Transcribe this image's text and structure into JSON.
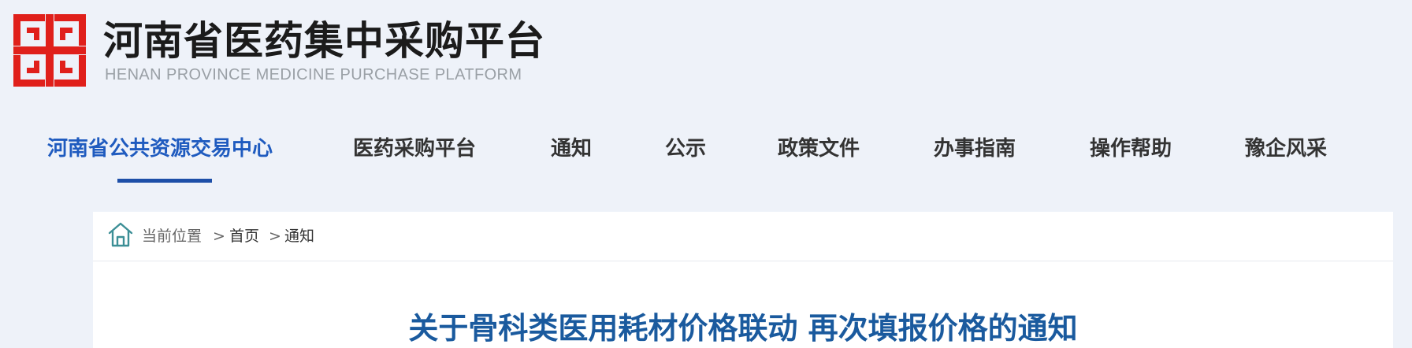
{
  "header": {
    "logo_icon": "hui-pattern-emblem",
    "title": "河南省医药集中采购平台",
    "subtitle": "HENAN PROVINCE MEDICINE PURCHASE PLATFORM"
  },
  "nav": {
    "items": [
      {
        "label": "河南省公共资源交易中心",
        "active": true
      },
      {
        "label": "医药采购平台",
        "active": false
      },
      {
        "label": "通知",
        "active": false
      },
      {
        "label": "公示",
        "active": false
      },
      {
        "label": "政策文件",
        "active": false
      },
      {
        "label": "办事指南",
        "active": false
      },
      {
        "label": "操作帮助",
        "active": false
      },
      {
        "label": "豫企风采",
        "active": false
      }
    ]
  },
  "breadcrumb": {
    "icon": "home-icon",
    "label": "当前位置",
    "separator": ">",
    "items": [
      "首页",
      "通知"
    ]
  },
  "article": {
    "title": "关于骨科类医用耗材价格联动 再次填报价格的通知"
  },
  "colors": {
    "page_background": "#eef2f9",
    "logo_red": "#e0201b",
    "nav_active": "#1f5bbf",
    "nav_underline": "#1d4fa8",
    "title_blue": "#1a5a9e",
    "home_icon": "#3c8f96"
  }
}
